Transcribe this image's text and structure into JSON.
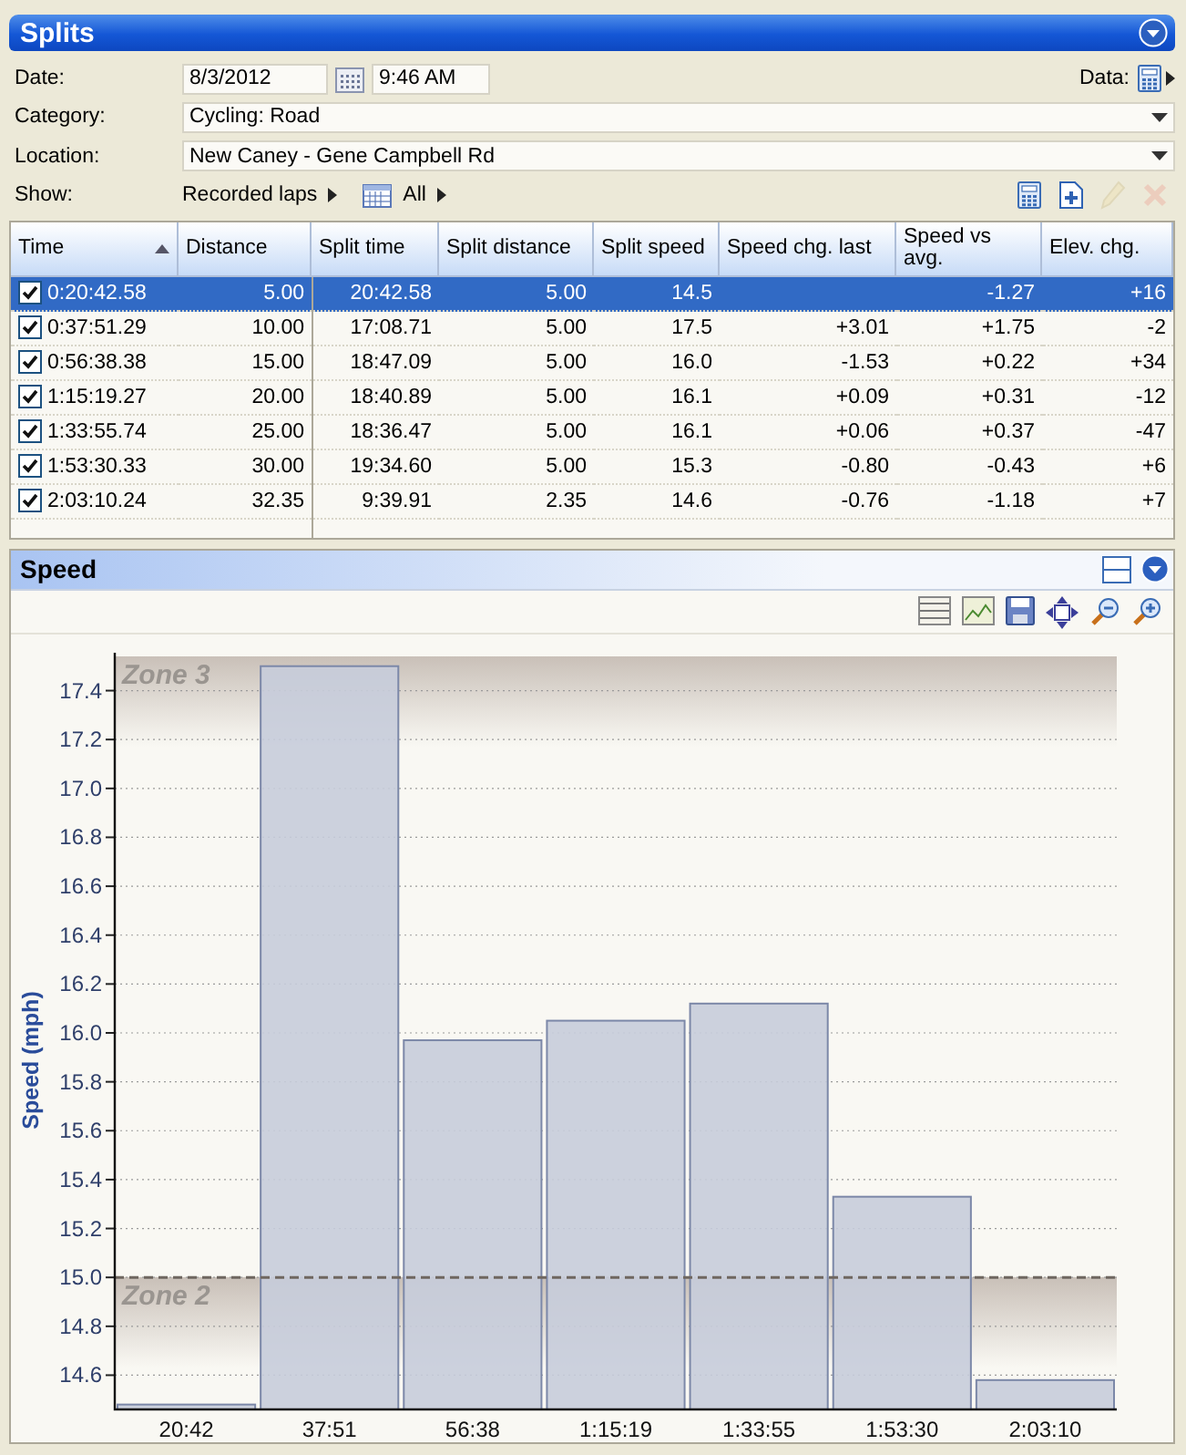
{
  "splits": {
    "title": "Splits",
    "form": {
      "date_label": "Date:",
      "date": "8/3/2012",
      "time": "9:46 AM",
      "data_label": "Data:",
      "category_label": "Category:",
      "category": "Cycling: Road",
      "location_label": "Location:",
      "location": "New Caney - Gene Campbell Rd",
      "show_label": "Show:",
      "show_laps": "Recorded laps",
      "show_all": "All"
    },
    "toolbar": [
      {
        "kind": "calculator",
        "disabled": false
      },
      {
        "kind": "add",
        "disabled": false
      },
      {
        "kind": "edit",
        "disabled": true
      },
      {
        "kind": "delete",
        "disabled": true
      }
    ],
    "table": {
      "columns": [
        {
          "label": "Time",
          "sorted": true
        },
        {
          "label": "Distance",
          "sorted": false
        },
        {
          "label": "Split time",
          "sorted": false
        },
        {
          "label": "Split distance",
          "sorted": false
        },
        {
          "label": "Split speed",
          "sorted": false
        },
        {
          "label": "Speed chg. last",
          "sorted": false
        },
        {
          "label": "Speed vs avg.",
          "sorted": false
        },
        {
          "label": "Elev. chg.",
          "sorted": false
        }
      ],
      "rows": [
        {
          "checked": true,
          "selected": true,
          "cells": [
            "0:20:42.58",
            "5.00",
            "20:42.58",
            "5.00",
            "14.5",
            null,
            "-1.27",
            "+16"
          ]
        },
        {
          "checked": true,
          "selected": false,
          "cells": [
            "0:37:51.29",
            "10.00",
            "17:08.71",
            "5.00",
            "17.5",
            "+3.01",
            "+1.75",
            "-2"
          ]
        },
        {
          "checked": true,
          "selected": false,
          "cells": [
            "0:56:38.38",
            "15.00",
            "18:47.09",
            "5.00",
            "16.0",
            "-1.53",
            "+0.22",
            "+34"
          ]
        },
        {
          "checked": true,
          "selected": false,
          "cells": [
            "1:15:19.27",
            "20.00",
            "18:40.89",
            "5.00",
            "16.1",
            "+0.09",
            "+0.31",
            "-12"
          ]
        },
        {
          "checked": true,
          "selected": false,
          "cells": [
            "1:33:55.74",
            "25.00",
            "18:36.47",
            "5.00",
            "16.1",
            "+0.06",
            "+0.37",
            "-47"
          ]
        },
        {
          "checked": true,
          "selected": false,
          "cells": [
            "1:53:30.33",
            "30.00",
            "19:34.60",
            "5.00",
            "15.3",
            "-0.80",
            "-0.43",
            "+6"
          ]
        },
        {
          "checked": true,
          "selected": false,
          "cells": [
            "2:03:10.24",
            "32.35",
            "9:39.91",
            "2.35",
            "14.6",
            "-0.76",
            "-1.18",
            "+7"
          ]
        }
      ]
    }
  },
  "speed": {
    "title": "Speed",
    "chart_data": {
      "type": "bar",
      "ylabel": "Speed (mph)",
      "categories": [
        "20:42",
        "37:51",
        "56:38",
        "1:15:19",
        "1:33:55",
        "1:53:30",
        "2:03:10"
      ],
      "series": [
        {
          "color": "#c7ccda",
          "values": [
            14.48,
            17.5,
            15.97,
            16.05,
            16.12,
            15.33,
            14.58
          ]
        }
      ],
      "grid": true,
      "ylim": [
        14.46,
        17.54
      ],
      "yticks": [
        {
          "value": 14.6,
          "label": "14.6"
        },
        {
          "value": 14.8,
          "label": "14.8"
        },
        {
          "value": 15.0,
          "label": "15.0"
        },
        {
          "value": 15.2,
          "label": "15.2"
        },
        {
          "value": 15.4,
          "label": "15.4"
        },
        {
          "value": 15.6,
          "label": "15.6"
        },
        {
          "value": 15.8,
          "label": "15.8"
        },
        {
          "value": 16.0,
          "label": "16.0"
        },
        {
          "value": 16.2,
          "label": "16.2"
        },
        {
          "value": 16.4,
          "label": "16.4"
        },
        {
          "value": 16.6,
          "label": "16.6"
        },
        {
          "value": 16.8,
          "label": "16.8"
        },
        {
          "value": 17.0,
          "label": "17.0"
        },
        {
          "value": 17.2,
          "label": "17.2"
        },
        {
          "value": 17.4,
          "label": "17.4"
        }
      ],
      "annotations": [
        "Zone 3",
        "Zone 2"
      ],
      "ref_lines": [
        {
          "axis": "y",
          "value": 15.0
        }
      ]
    }
  }
}
